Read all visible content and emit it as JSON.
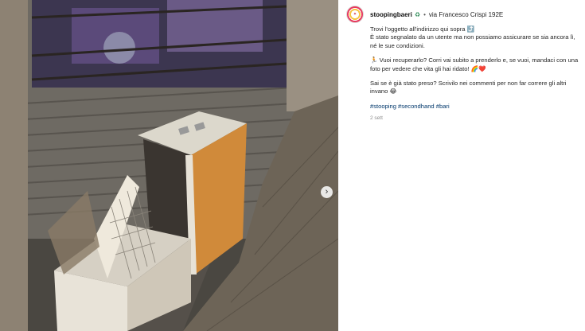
{
  "post": {
    "username": "stoopingbaeri",
    "verified_icon": "recycle",
    "separator": "•",
    "location": "via Francesco Crispi 192E",
    "caption_lines": [
      "Trovi l'oggetto all'indirizzo qui sopra ⤴️",
      "È stato segnalato da un utente ma non possiamo assicurare se sia ancora lì, né le sue condizioni.",
      "🏃 Vuoi recuperarlo? Corri vai subito a prenderlo e, se vuoi, mandaci con una foto per vedere che vita gli hai ridato! 🌈❤️",
      "Sai se è già stato preso? Scrivilo nei commenti per non far correre gli altri invano 😂"
    ],
    "hashtags": "#stooping #secondhand #bari",
    "time_ago": "2 sett",
    "next_icon": "›"
  },
  "colors": {
    "link": "#00376b",
    "muted": "#8e8e8e"
  }
}
